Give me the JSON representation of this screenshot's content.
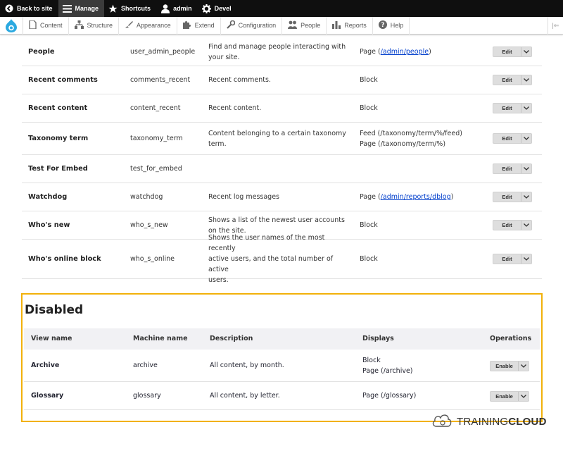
{
  "toolbar": {
    "back": "Back to site",
    "manage": "Manage",
    "shortcuts": "Shortcuts",
    "user": "admin",
    "devel": "Devel"
  },
  "tray": {
    "items": [
      "Content",
      "Structure",
      "Appearance",
      "Extend",
      "Configuration",
      "People",
      "Reports",
      "Help"
    ]
  },
  "enabled_rows": [
    {
      "name": "People",
      "machine": "user_admin_people",
      "desc": [
        "Find and manage people interacting with",
        "your site."
      ],
      "disp_pre": "Page (",
      "disp_link": "/admin/people",
      "disp_post": ")",
      "op": "Edit"
    },
    {
      "name": "Recent comments",
      "machine": "comments_recent",
      "desc": [
        "Recent comments."
      ],
      "disp": [
        "Block"
      ],
      "op": "Edit"
    },
    {
      "name": "Recent content",
      "machine": "content_recent",
      "desc": [
        "Recent content."
      ],
      "disp": [
        "Block"
      ],
      "op": "Edit"
    },
    {
      "name": "Taxonomy term",
      "machine": "taxonomy_term",
      "desc": [
        "Content belonging to a certain taxonomy",
        "term."
      ],
      "disp": [
        "Feed (/taxonomy/term/%/feed)",
        "Page (/taxonomy/term/%)"
      ],
      "op": "Edit"
    },
    {
      "name": "Test For Embed",
      "machine": "test_for_embed",
      "desc": [],
      "disp": [],
      "op": "Edit"
    },
    {
      "name": "Watchdog",
      "machine": "watchdog",
      "desc": [
        "Recent log messages"
      ],
      "disp_pre": "Page (",
      "disp_link": "/admin/reports/dblog",
      "disp_post": ")",
      "op": "Edit"
    },
    {
      "name": "Who's new",
      "machine": "who_s_new",
      "desc": [
        "Shows a list of the newest user accounts",
        "on the site."
      ],
      "disp": [
        "Block"
      ],
      "op": "Edit"
    },
    {
      "name": "Who's online block",
      "machine": "who_s_online",
      "desc": [
        "Shows the user names of the most recently",
        "active users, and the total number of active",
        "users."
      ],
      "disp": [
        "Block"
      ],
      "op": "Edit"
    }
  ],
  "disabled": {
    "title": "Disabled",
    "headers": {
      "name": "View name",
      "machine": "Machine name",
      "desc": "Description",
      "disp": "Displays",
      "ops": "Operations"
    },
    "rows": [
      {
        "name": "Archive",
        "machine": "archive",
        "desc": "All content, by month.",
        "disp": [
          "Block",
          "Page (/archive)"
        ],
        "op": "Enable"
      },
      {
        "name": "Glossary",
        "machine": "glossary",
        "desc": "All content, by letter.",
        "disp": [
          "Page (/glossary)"
        ],
        "op": "Enable"
      }
    ]
  },
  "brand": {
    "part1": "TRAINING",
    "part2": "CLOUD"
  },
  "colors": {
    "highlight": "#f2b10a",
    "link": "#003ecc",
    "toolbar": "#0f0f0f"
  }
}
